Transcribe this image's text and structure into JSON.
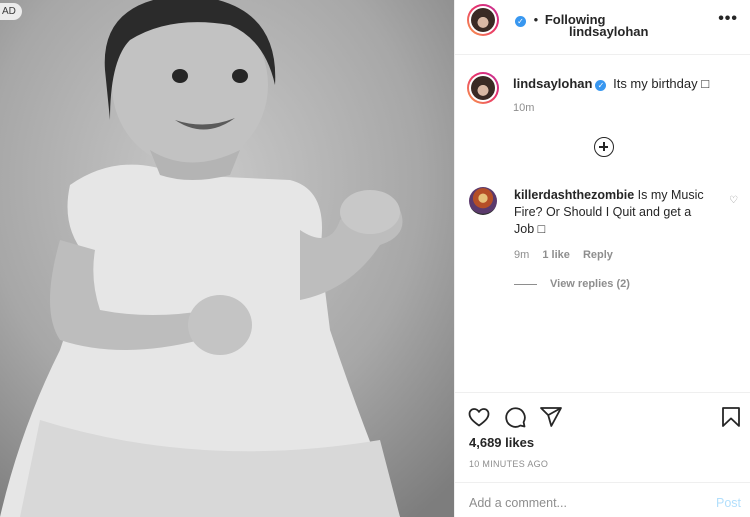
{
  "ad_badge": "AD",
  "post": {
    "username": "lindsaylohan",
    "separator": "•",
    "follow_state": "Following",
    "more_menu": "•••",
    "caption_text": "Its my birthday □",
    "caption_time": "10m"
  },
  "comment": {
    "username": "killerdashthezombie",
    "text": "Is my Music Fire? Or Should I Quit and get a Job □",
    "time": "9m",
    "likes": "1 like",
    "reply": "Reply",
    "view_replies": "View replies (2)"
  },
  "actions": {
    "likes_count": "4,689 likes",
    "time_ago": "10 MINUTES AGO",
    "comment_placeholder": "Add a comment...",
    "post_label": "Post"
  },
  "icons": {
    "verified": "verified-badge-icon",
    "heart": "heart-icon",
    "comment": "comment-icon",
    "share": "share-icon",
    "bookmark": "bookmark-icon",
    "add": "plus-circle-icon"
  },
  "colors": {
    "verified_blue": "#3897f0",
    "post_disabled": "#b2dffc",
    "muted": "#8e8e8e"
  }
}
